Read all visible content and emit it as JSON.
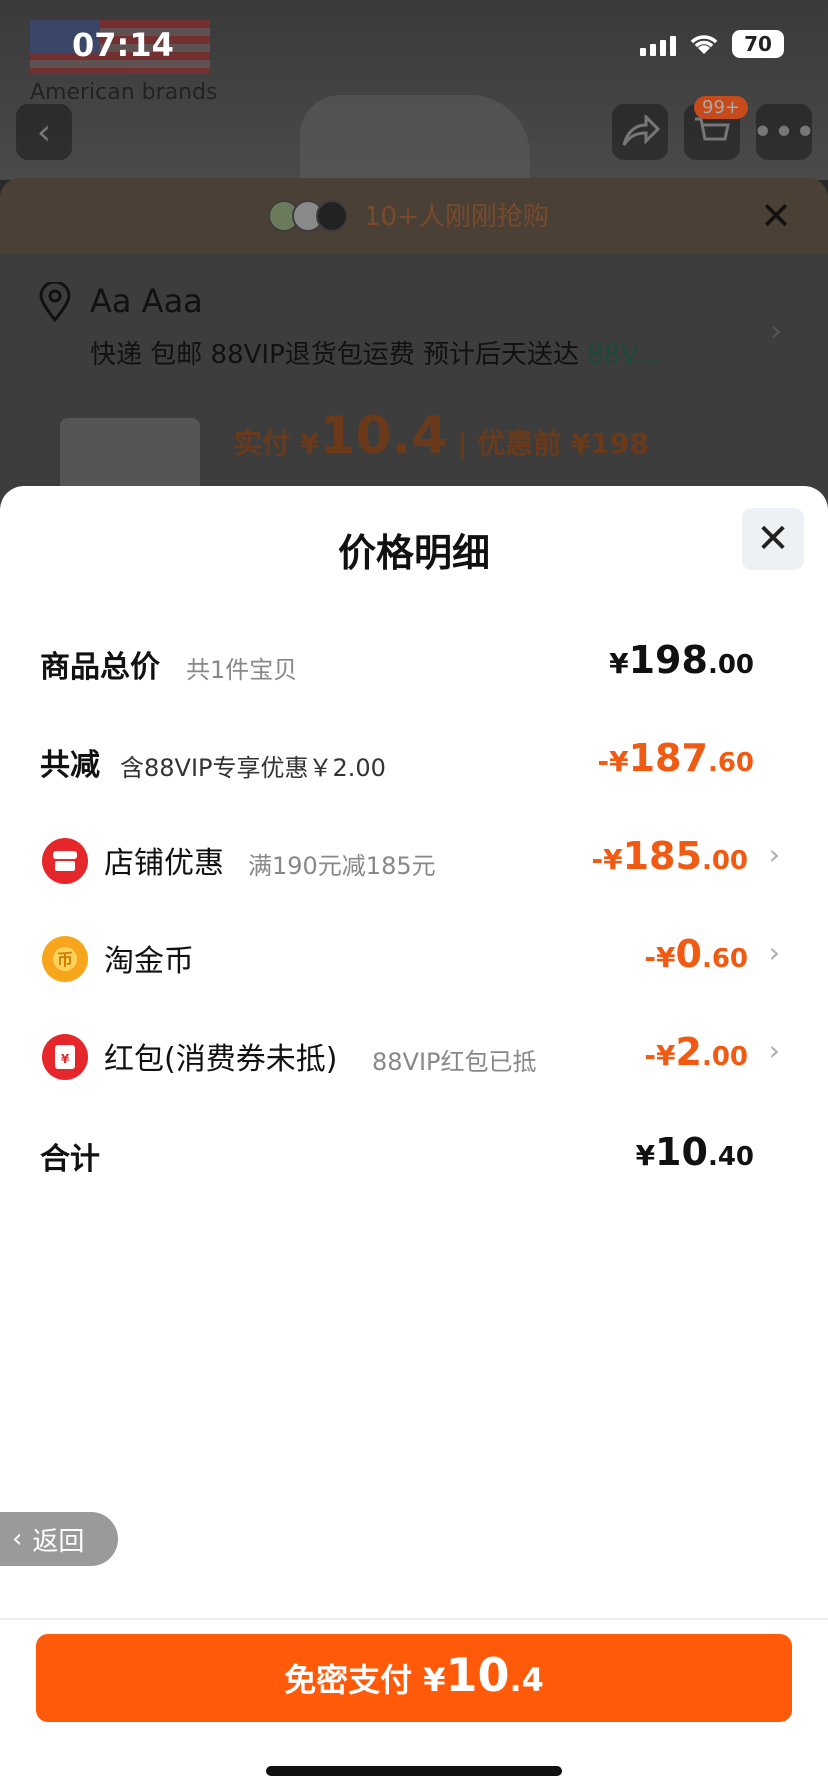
{
  "status_bar": {
    "time": "07:14",
    "battery": "70"
  },
  "background": {
    "brand_text": "American brands",
    "cart_badge": "99+",
    "buyers_text": "10+人刚刚抢购",
    "address_name": "Aa Aaa",
    "shipping_text": "快递 包邮 88VIP退货包运费 预计后天送达 ",
    "shipping_vip": "88V...",
    "price_label": "实付 ¥",
    "price_int": "10.4",
    "price_before": "| 优惠前 ¥198"
  },
  "sheet": {
    "title": "价格明细",
    "rows": [
      {
        "label": "商品总价",
        "sub": "共1件宝贝",
        "yuan": "¥",
        "int": "198",
        "dec": ".00"
      },
      {
        "label": "共减",
        "sub": "含88VIP专享优惠￥2.00",
        "yuan": "-¥",
        "int": "187",
        "dec": ".60"
      },
      {
        "label": "店铺优惠",
        "sub": "满190元减185元",
        "yuan": "-¥",
        "int": "185",
        "dec": ".00",
        "icon": "shop-icon",
        "color": "#e5262b"
      },
      {
        "label": "淘金币",
        "sub": "",
        "yuan": "-¥",
        "int": "0",
        "dec": ".60",
        "icon": "coin-icon",
        "color": "#f7a51c"
      },
      {
        "label": "红包(消费券未抵)",
        "sub": "88VIP红包已抵",
        "yuan": "-¥",
        "int": "2",
        "dec": ".00",
        "icon": "red-envelope-icon",
        "color": "#e5262b"
      },
      {
        "label": "合计",
        "sub": "",
        "yuan": "¥",
        "int": "10",
        "dec": ".40"
      }
    ],
    "back_label": "返回",
    "pay": {
      "label": "免密支付 ¥",
      "int": "10",
      "dec": ".4"
    }
  },
  "colors": {
    "accent": "#ff5a0a",
    "discount": "#f05a12"
  }
}
